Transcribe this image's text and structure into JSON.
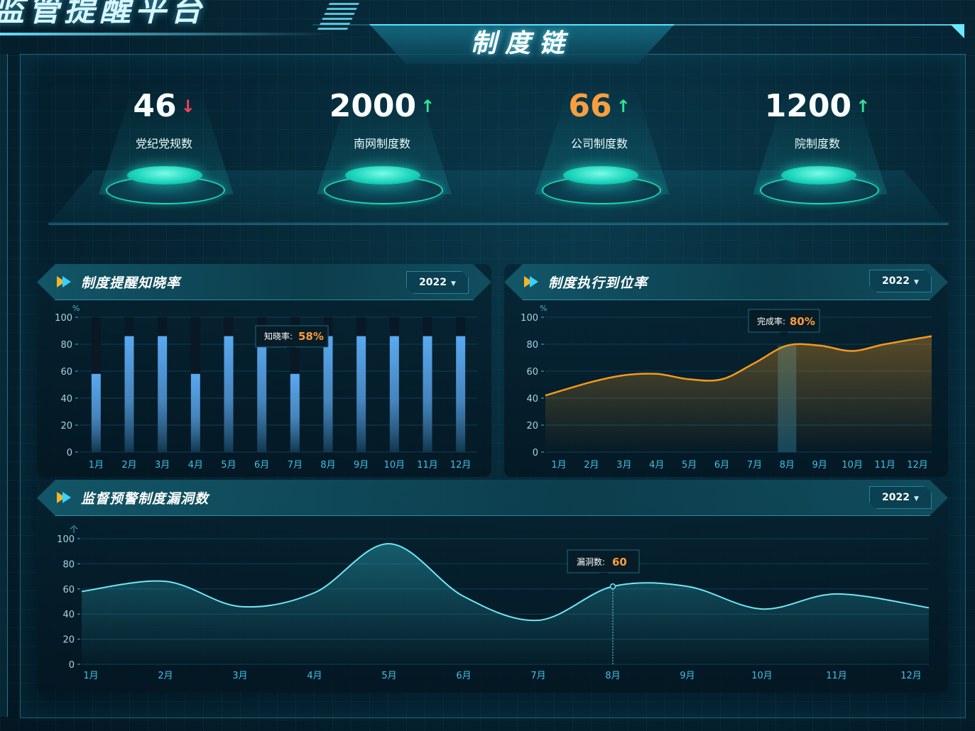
{
  "app": {
    "title": "监管提醒平台"
  },
  "header": {
    "title": "制度链"
  },
  "stats": [
    {
      "value": "46",
      "label": "党纪党规数",
      "trend": "down",
      "color": "#ffffff"
    },
    {
      "value": "2000",
      "label": "南网制度数",
      "trend": "up",
      "color": "#ffffff"
    },
    {
      "value": "66",
      "label": "公司制度数",
      "trend": "up",
      "color": "#ff9d3b"
    },
    {
      "value": "1200",
      "label": "院制度数",
      "trend": "up",
      "color": "#ffffff"
    }
  ],
  "arrows": {
    "up": "↑",
    "down": "↓"
  },
  "panels": {
    "awareness": {
      "title": "制度提醒知晓率",
      "year": "2022",
      "unit": "%",
      "tooltip_label": "知晓率:",
      "tooltip_value": "58%"
    },
    "execution": {
      "title": "制度执行到位率",
      "year": "2022",
      "unit": "%",
      "tooltip_label": "完成率:",
      "tooltip_value": "80%"
    },
    "loophole": {
      "title": "监督预警制度漏洞数",
      "year": "2022",
      "unit": "个",
      "tooltip_label": "漏洞数:",
      "tooltip_value": "60"
    }
  },
  "colors": {
    "accent": "#5fe0ff",
    "bar": "#5aa9f0",
    "line_orange": "#f39a1e",
    "line_cyan": "#6ee6f5",
    "tooltip_value": "#ff9d3b"
  },
  "chart_data": [
    {
      "type": "bar",
      "title": "制度提醒知晓率",
      "ylabel": "%",
      "ylim": [
        0,
        100
      ],
      "yticks": [
        0,
        20,
        40,
        60,
        80,
        100
      ],
      "categories": [
        "1月",
        "2月",
        "3月",
        "4月",
        "5月",
        "6月",
        "7月",
        "8月",
        "9月",
        "10月",
        "11月",
        "12月"
      ],
      "values": [
        58,
        86,
        86,
        58,
        86,
        86,
        58,
        86,
        86,
        86,
        86,
        86
      ],
      "highlight_index": 6,
      "grid": true
    },
    {
      "type": "line",
      "title": "制度执行到位率",
      "ylabel": "%",
      "ylim": [
        0,
        100
      ],
      "yticks": [
        0,
        20,
        40,
        60,
        80,
        100
      ],
      "categories": [
        "1月",
        "2月",
        "3月",
        "4月",
        "5月",
        "6月",
        "7月",
        "8月",
        "9月",
        "10月",
        "11月",
        "12月"
      ],
      "values": [
        42,
        52,
        57,
        58,
        54,
        54,
        66,
        79,
        79,
        75,
        80,
        86
      ],
      "highlight_index": 7,
      "grid": true
    },
    {
      "type": "area",
      "title": "监督预警制度漏洞数",
      "ylabel": "个",
      "ylim": [
        0,
        100
      ],
      "yticks": [
        0,
        20,
        40,
        60,
        80,
        100
      ],
      "categories": [
        "1月",
        "2月",
        "3月",
        "4月",
        "5月",
        "6月",
        "7月",
        "8月",
        "9月",
        "10月",
        "11月",
        "12月"
      ],
      "values": [
        58,
        66,
        46,
        57,
        96,
        54,
        35,
        62,
        62,
        44,
        56,
        45
      ],
      "highlight_index": 7,
      "grid": true
    }
  ]
}
